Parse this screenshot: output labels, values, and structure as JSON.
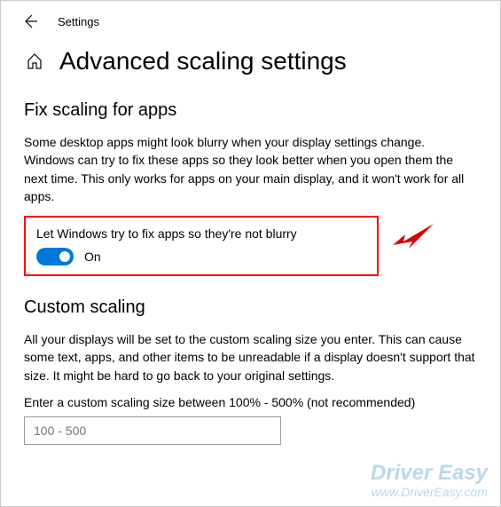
{
  "topbar": {
    "settings_label": "Settings"
  },
  "page": {
    "title": "Advanced scaling settings"
  },
  "fix_scaling": {
    "heading": "Fix scaling for apps",
    "description": "Some desktop apps might look blurry when your display settings change. Windows can try to fix these apps so they look better when you open them the next time. This only works for apps on your main display, and it won't work for all apps.",
    "toggle_label": "Let Windows try to fix apps so they're not blurry",
    "toggle_state": "On"
  },
  "custom_scaling": {
    "heading": "Custom scaling",
    "description": "All your displays will be set to the custom scaling size you enter. This can cause some text, apps, and other items to be unreadable if a display doesn't support that size. It might be hard to go back to your original settings.",
    "input_label": "Enter a custom scaling size between 100% - 500% (not recommended)",
    "input_placeholder": "100 - 500"
  },
  "watermark": {
    "title": "Driver Easy",
    "url": "www.DriverEasy.com"
  }
}
